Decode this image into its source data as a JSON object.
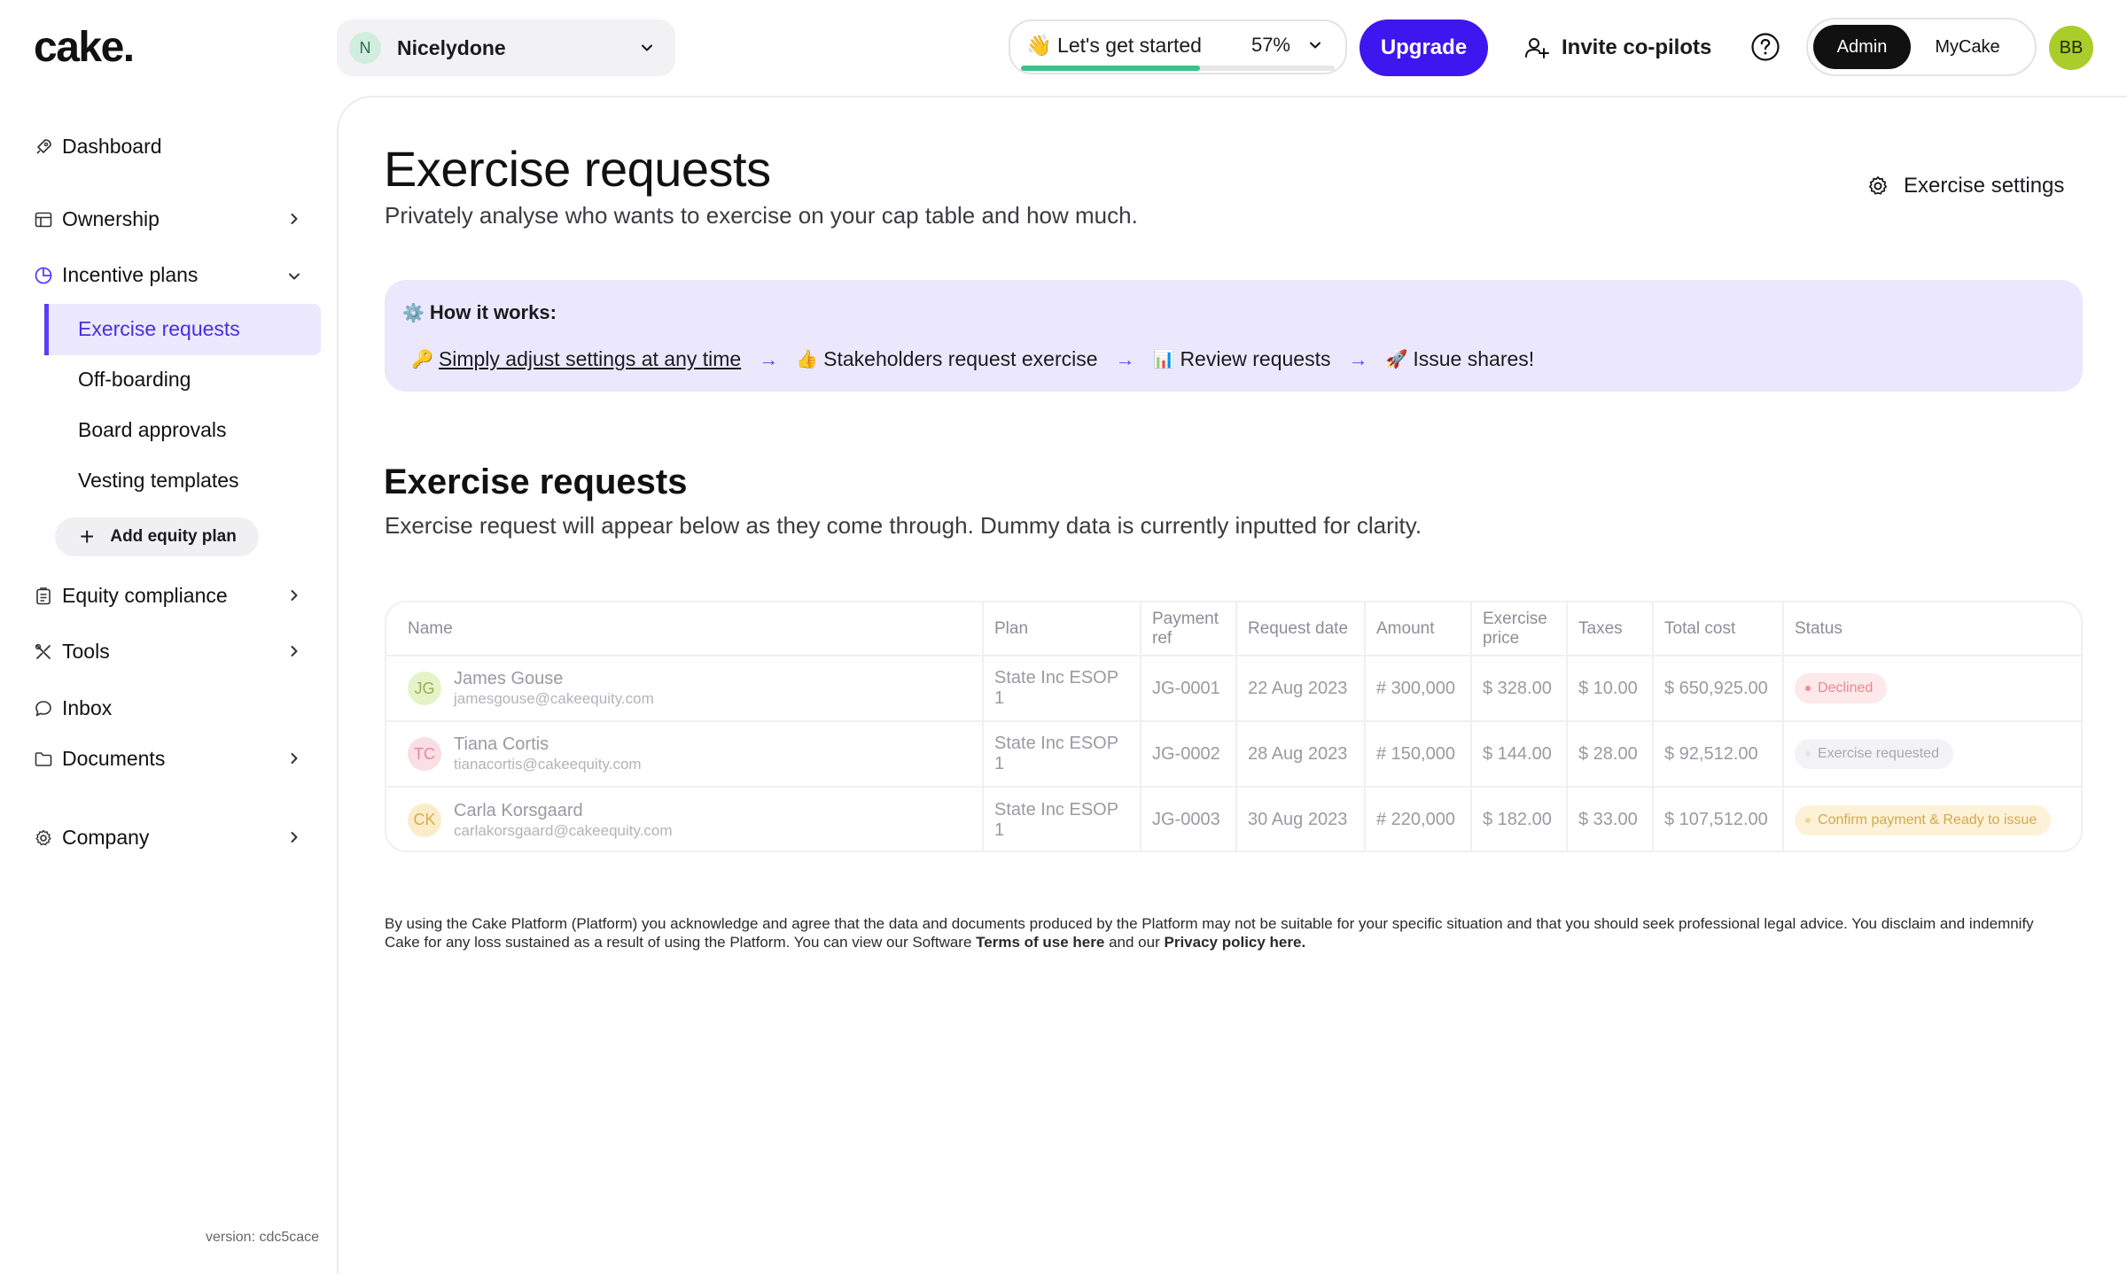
{
  "app": {
    "logo": "cake."
  },
  "header": {
    "company_initial": "N",
    "company_name": "Nicelydone",
    "progress_label": "👋 Let's get started",
    "progress_percent": "57%",
    "progress_value": 0.57,
    "upgrade_label": "Upgrade",
    "invite_label": "Invite co-pilots",
    "mode_admin": "Admin",
    "mode_mycake": "MyCake",
    "user_initials": "BB"
  },
  "sidebar": {
    "dashboard": "Dashboard",
    "ownership": "Ownership",
    "incentive_plans": "Incentive plans",
    "sub_items": [
      "Exercise requests",
      "Off-boarding",
      "Board approvals",
      "Vesting templates"
    ],
    "add_plan": "Add equity plan",
    "equity_compliance": "Equity compliance",
    "tools": "Tools",
    "inbox": "Inbox",
    "documents": "Documents",
    "company": "Company",
    "version": "version: cdc5cace"
  },
  "page": {
    "title": "Exercise requests",
    "subtitle": "Privately analyse who wants to exercise on your cap table and how much.",
    "settings_label": "Exercise settings"
  },
  "how_it_works": {
    "title": "How it works:",
    "steps": [
      {
        "emoji": "🔑",
        "label": "Simply adjust settings at any time"
      },
      {
        "emoji": "👍",
        "label": "Stakeholders request exercise"
      },
      {
        "emoji": "📊",
        "label": "Review requests"
      },
      {
        "emoji": "🚀",
        "label": "Issue shares!"
      }
    ]
  },
  "requests": {
    "title": "Exercise requests",
    "subtitle": "Exercise request will appear below as they come through. Dummy data is currently inputted for clarity.",
    "columns": {
      "name": "Name",
      "plan": "Plan",
      "payment_ref": "Payment ref",
      "request_date": "Request date",
      "amount": "Amount",
      "exercise_price": "Exercise price",
      "taxes": "Taxes",
      "total_cost": "Total cost",
      "status": "Status"
    },
    "rows": [
      {
        "initials": "JG",
        "avatar_bg": "#e6f2c8",
        "avatar_fg": "#9ab24f",
        "name": "James Gouse",
        "email": "jamesgouse@cakeequity.com",
        "plan": "State Inc ESOP 1",
        "payment_ref": "JG-0001",
        "request_date": "22 Aug 2023",
        "amount": "# 300,000",
        "exercise_price": "$ 328.00",
        "taxes": "$ 10.00",
        "total_cost": "$ 650,925.00",
        "status": "Declined",
        "status_bg": "#fde8ea",
        "status_fg": "#e68a93",
        "status_dot": "#ef8f98"
      },
      {
        "initials": "TC",
        "avatar_bg": "#fbdde4",
        "avatar_fg": "#e2899b",
        "name": "Tiana Cortis",
        "email": "tianacortis@cakeequity.com",
        "plan": "State Inc ESOP 1",
        "payment_ref": "JG-0002",
        "request_date": "28 Aug 2023",
        "amount": "# 150,000",
        "exercise_price": "$ 144.00",
        "taxes": "$ 28.00",
        "total_cost": "$ 92,512.00",
        "status": "Exercise requested",
        "status_bg": "#f3f3f5",
        "status_fg": "#a8a8b0",
        "status_dot": "#e4e4e8"
      },
      {
        "initials": "CK",
        "avatar_bg": "#fbecc9",
        "avatar_fg": "#d8ac4e",
        "name": "Carla Korsgaard",
        "email": "carlakorsgaard@cakeequity.com",
        "plan": "State Inc ESOP 1",
        "payment_ref": "JG-0003",
        "request_date": "30 Aug 2023",
        "amount": "# 220,000",
        "exercise_price": "$ 182.00",
        "taxes": "$ 33.00",
        "total_cost": "$ 107,512.00",
        "status": "Confirm payment & Ready to issue",
        "status_bg": "#fdf2d8",
        "status_fg": "#d4a84c",
        "status_dot": "#f3d58e"
      }
    ]
  },
  "footer": {
    "disclaimer": "By using the Cake Platform (Platform) you acknowledge and agree that the data and documents produced by the Platform may not be suitable for your specific situation and that you should seek professional legal advice. You disclaim and indemnify Cake for any loss sustained as a result of using the Platform. You can view our Software",
    "terms_link": "Terms of use here",
    "and_our": "and our",
    "privacy_link": "Privacy policy here."
  }
}
